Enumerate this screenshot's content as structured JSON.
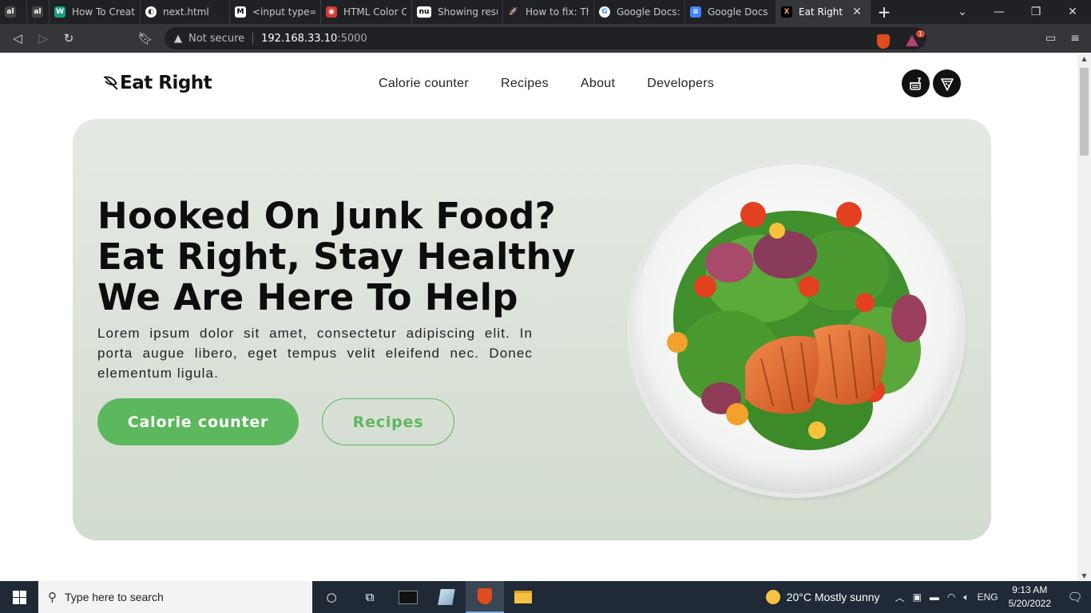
{
  "browser": {
    "tabs": [
      {
        "title": "",
        "favicon_text": "al",
        "favicon_color": "#4a4a4a"
      },
      {
        "title": "",
        "favicon_text": "al",
        "favicon_color": "#4a4a4a"
      },
      {
        "title": "How To Create",
        "favicon_text": "W",
        "favicon_color": "#16a085"
      },
      {
        "title": "next.html",
        "favicon_text": "◐",
        "favicon_color": "#555555"
      },
      {
        "title": "<input type=\"",
        "favicon_text": "M",
        "favicon_color": "#2b2b2b"
      },
      {
        "title": "HTML Color Cc",
        "favicon_text": "◉",
        "favicon_color": "#d33b32"
      },
      {
        "title": "Showing result",
        "favicon_text": "nu",
        "favicon_color": "#1a1a1a"
      },
      {
        "title": "How to fix: The",
        "favicon_text": "🚀",
        "favicon_color": "#202124"
      },
      {
        "title": "Google Docs: C",
        "favicon_text": "G",
        "favicon_color": "#ffffff"
      },
      {
        "title": "Google Docs",
        "favicon_text": "≡",
        "favicon_color": "#4285f4"
      },
      {
        "title": "Eat Right",
        "favicon_text": "X",
        "favicon_color": "#1a1a1a",
        "active": true
      }
    ],
    "address": {
      "security": "Not secure",
      "host": "192.168.33.10",
      "port": ":5000"
    },
    "rewards_badge": "1"
  },
  "site": {
    "brand": "Eat Right",
    "nav": [
      "Calorie counter",
      "Recipes",
      "About",
      "Developers"
    ],
    "hero": {
      "headline": [
        "Hooked On Junk Food?",
        "Eat Right, Stay Healthy",
        "We Are Here To Help"
      ],
      "lede": "Lorem ipsum dolor sit amet, consectetur adipiscing elit. In porta augue libero, eget tempus velit eleifend nec. Donec elementum ligula.",
      "primary_button": "Calorie counter",
      "secondary_button": "Recipes"
    },
    "colors": {
      "accent": "#5cb85c",
      "hero_bg_top": "#e5e9e3",
      "hero_bg_bottom": "#d2dccf",
      "text": "#0d0d0d"
    }
  },
  "taskbar": {
    "search_placeholder": "Type here to search",
    "weather": "20°C  Mostly sunny",
    "language": "ENG",
    "time": "9:13 AM",
    "date": "5/20/2022"
  }
}
